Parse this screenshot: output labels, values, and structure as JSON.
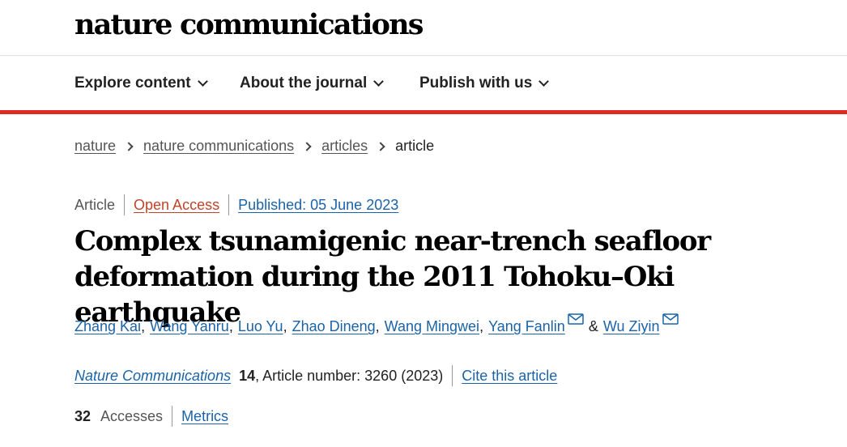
{
  "brand": {
    "logo_text": "nature communications"
  },
  "nav": {
    "items": [
      {
        "label": "Explore content"
      },
      {
        "label": "About the journal"
      },
      {
        "label": "Publish with us"
      }
    ]
  },
  "breadcrumb": {
    "items": [
      "nature",
      "nature communications",
      "articles"
    ],
    "current": "article"
  },
  "article": {
    "type": "Article",
    "access": "Open Access",
    "published": "Published: 05 June 2023",
    "title": "Complex tsunamigenic near-trench seafloor deformation during the 2011 Tohoku–Oki earthquake",
    "authors": [
      {
        "name": "Zhang Kai"
      },
      {
        "name": "Wang Yanru"
      },
      {
        "name": "Luo Yu"
      },
      {
        "name": "Zhao Dineng"
      },
      {
        "name": "Wang Mingwei"
      },
      {
        "name": "Yang Fanlin",
        "corresponding": true
      },
      {
        "name": "Wu Ziyin",
        "corresponding": true
      }
    ],
    "author_separator": ",",
    "author_conjunction": "&",
    "journal": "Nature Communications",
    "volume": "14",
    "article_number": ", Article number: 3260 (2023)",
    "cite_label": "Cite this article",
    "accesses_count": "32",
    "accesses_label": "Accesses",
    "metrics_label": "Metrics"
  },
  "colors": {
    "accent_bar": "#e02a20",
    "link": "#1a63a8",
    "open_access": "#c0432a"
  },
  "icons": {
    "nav_dropdown": "chevron-down-icon",
    "breadcrumb_separator": "chevron-right-icon",
    "corresponding_author": "mail-icon"
  }
}
